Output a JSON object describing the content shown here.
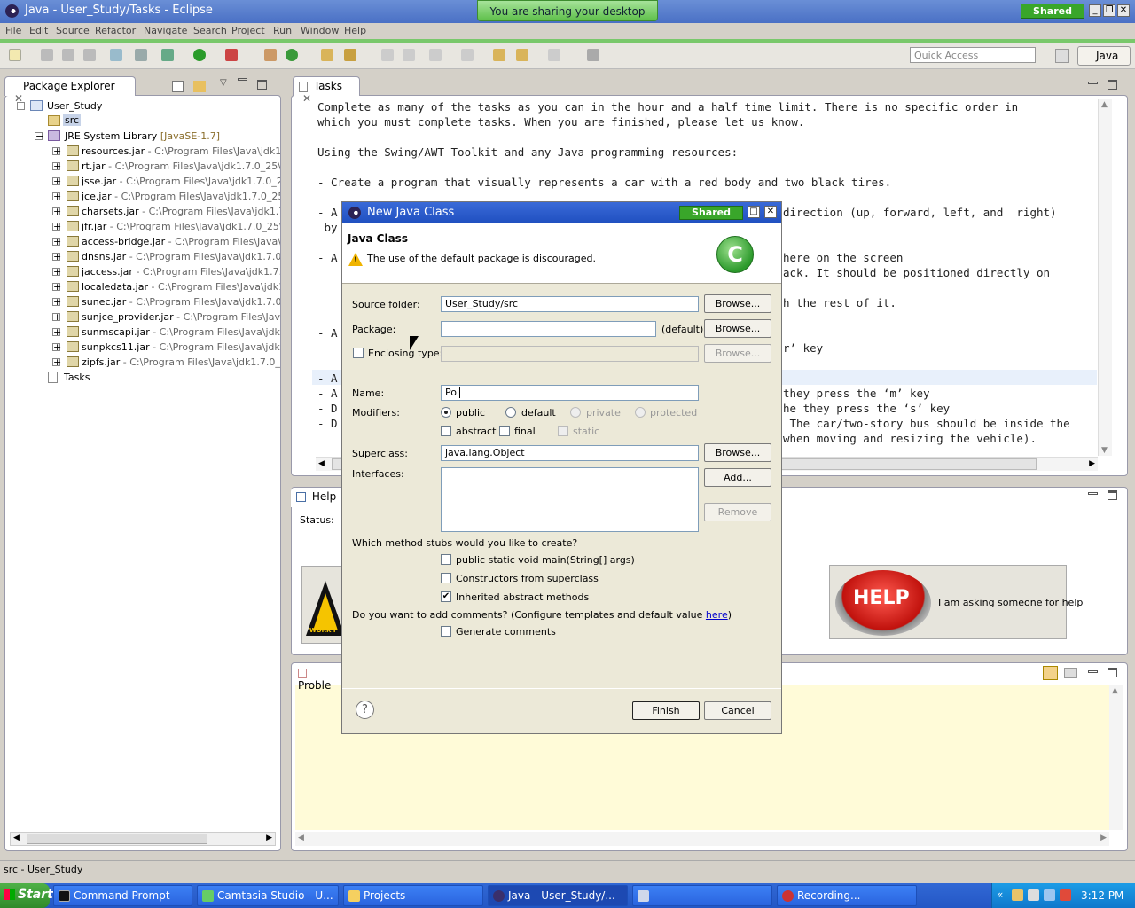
{
  "window": {
    "title": "Java - User_Study/Tasks - Eclipse",
    "sharing_banner": "You are sharing your desktop",
    "shared_badge": "Shared"
  },
  "menu": [
    "File",
    "Edit",
    "Source",
    "Refactor",
    "Navigate",
    "Search",
    "Project",
    "Run",
    "Window",
    "Help"
  ],
  "toolbar": {
    "quick_access_placeholder": "Quick Access",
    "perspective": "Java"
  },
  "package_explorer": {
    "tab": "Package Explorer",
    "project": "User_Study",
    "src": "src",
    "jre": {
      "name": "JRE System Library",
      "version": "[JavaSE-1.7]"
    },
    "jars": [
      {
        "name": "resources.jar",
        "path": " - C:\\Program Files\\Java\\jdk1.7."
      },
      {
        "name": "rt.jar",
        "path": " - C:\\Program Files\\Java\\jdk1.7.0_25\\jre"
      },
      {
        "name": "jsse.jar",
        "path": " - C:\\Program Files\\Java\\jdk1.7.0_25\\"
      },
      {
        "name": "jce.jar",
        "path": " - C:\\Program Files\\Java\\jdk1.7.0_25\\j"
      },
      {
        "name": "charsets.jar",
        "path": " - C:\\Program Files\\Java\\jdk1.7.0"
      },
      {
        "name": "jfr.jar",
        "path": " - C:\\Program Files\\Java\\jdk1.7.0_25\\jr"
      },
      {
        "name": "access-bridge.jar",
        "path": " - C:\\Program Files\\Java\\jdk"
      },
      {
        "name": "dnsns.jar",
        "path": " - C:\\Program Files\\Java\\jdk1.7.0_2"
      },
      {
        "name": "jaccess.jar",
        "path": " - C:\\Program Files\\Java\\jdk1.7.0_"
      },
      {
        "name": "localedata.jar",
        "path": " - C:\\Program Files\\Java\\jdk1.7"
      },
      {
        "name": "sunec.jar",
        "path": " - C:\\Program Files\\Java\\jdk1.7.0_2"
      },
      {
        "name": "sunjce_provider.jar",
        "path": " - C:\\Program Files\\Java\\j"
      },
      {
        "name": "sunmscapi.jar",
        "path": " - C:\\Program Files\\Java\\jdk1.7"
      },
      {
        "name": "sunpkcs11.jar",
        "path": " - C:\\Program Files\\Java\\jdk1.7"
      },
      {
        "name": "zipfs.jar",
        "path": " - C:\\Program Files\\Java\\jdk1.7.0_25"
      }
    ],
    "tasks_file": "Tasks"
  },
  "editor": {
    "tab": "Tasks",
    "lines": [
      "Complete as many of the tasks as you can in the hour and a half time limit. There is no specific order in",
      "which you must complete tasks. When you are finished, please let us know.",
      "",
      "Using the Swing/AWT Toolkit and any Java programming resources:",
      "",
      "- Create a program that visually represents a car with a red body and two black tires.",
      "",
      "- A",
      " by",
      "",
      "- A",
      "",
      "",
      "",
      "",
      "- A",
      "",
      "",
      "- A",
      "- A",
      "- D",
      "- D"
    ],
    "right_fragments": [
      "direction (up, forward, left, and  right)",
      "here on the screen",
      "ack. It should be positioned directly on",
      "h the rest of it.",
      "r’ key",
      "they press the ‘m’ key",
      "he they press the ‘s’ key",
      " The car/two-story bus should be inside the",
      "when moving and resizing the vehicle)."
    ]
  },
  "help_view": {
    "tab": "Help",
    "status_label": "Status:",
    "help_caption": "I am asking someone for help",
    "help_button_text": "HELP",
    "work_sign_text": "WORK I"
  },
  "problems_view": {
    "tab": "Proble"
  },
  "dialog": {
    "title": "New Java Class",
    "shared_badge": "Shared",
    "heading": "Java Class",
    "warning": "The use of the default package is discouraged.",
    "source_folder_label": "Source folder:",
    "source_folder_value": "User_Study/src",
    "package_label": "Package:",
    "package_value": "",
    "package_default": "(default)",
    "enclosing_label": "Enclosing type:",
    "name_label": "Name:",
    "name_value": "Poi",
    "modifiers_label": "Modifiers:",
    "modifiers": [
      "public",
      "default",
      "private",
      "protected"
    ],
    "modifiers2": [
      "abstract",
      "final",
      "static"
    ],
    "superclass_label": "Superclass:",
    "superclass_value": "java.lang.Object",
    "interfaces_label": "Interfaces:",
    "browse": "Browse...",
    "add": "Add...",
    "remove": "Remove",
    "stubs_question": "Which method stubs would you like to create?",
    "stubs": [
      "public static void main(String[] args)",
      "Constructors from superclass",
      "Inherited abstract methods"
    ],
    "comments_question_pre": "Do you want to add comments? (Configure templates and default value ",
    "comments_link": "here",
    "comments_question_post": ")",
    "generate_comments": "Generate comments",
    "finish": "Finish",
    "cancel": "Cancel"
  },
  "status_bar": {
    "text": "src - User_Study"
  },
  "taskbar": {
    "start": "Start",
    "items": [
      "Command Prompt",
      "Camtasia Studio - U...",
      "Projects",
      "Java - User_Study/...",
      "",
      "Recording..."
    ],
    "clock": "3:12 PM"
  }
}
